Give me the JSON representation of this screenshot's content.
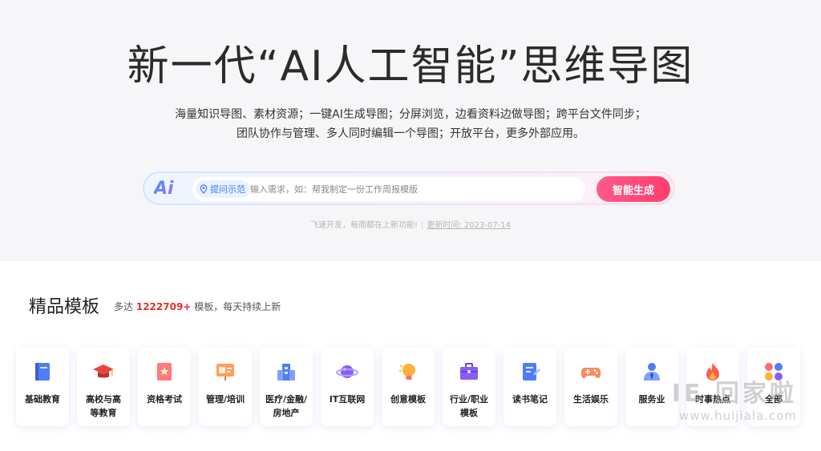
{
  "hero": {
    "title": "新一代“AI人工智能”思维导图",
    "desc_line1": "海量知识导图、素材资源；一键AI生成导图；分屏浏览，边看资料边做导图；跨平台文件同步；",
    "desc_line2": "团队协作与管理、多人同时编辑一个导图；开放平台，更多外部应用。"
  },
  "search": {
    "logo": "Ai",
    "hint_chip": "提问示范",
    "placeholder": "输入需求，如：帮我制定一份工作周报模版",
    "button": "智能生成"
  },
  "update": {
    "text": "飞速开发，每周都在上新功能!",
    "date": "更新时间: 2023-07-14"
  },
  "section": {
    "title": "精品模板",
    "sub_prefix": "多达",
    "count": "1222709+",
    "sub_suffix": "模板，每天持续上新"
  },
  "categories": [
    {
      "label": "基础教育",
      "icon": "book-icon"
    },
    {
      "label": "高校与高等教育",
      "icon": "graduation-cap-icon"
    },
    {
      "label": "资格考试",
      "icon": "certificate-icon"
    },
    {
      "label": "管理/培训",
      "icon": "presentation-icon"
    },
    {
      "label": "医疗/金融/房地产",
      "icon": "building-icon"
    },
    {
      "label": "IT互联网",
      "icon": "planet-icon"
    },
    {
      "label": "创意模板",
      "icon": "lightbulb-icon"
    },
    {
      "label": "行业/职业模板",
      "icon": "briefcase-icon"
    },
    {
      "label": "读书笔记",
      "icon": "notebook-icon"
    },
    {
      "label": "生活娱乐",
      "icon": "gamepad-icon"
    },
    {
      "label": "服务业",
      "icon": "service-icon"
    },
    {
      "label": "时事热点",
      "icon": "fire-icon"
    },
    {
      "label": "全部",
      "icon": "grid-icon"
    }
  ],
  "watermark": {
    "line1": "IE 回家啦",
    "line2": "www.huijiala.com"
  },
  "colors": {
    "accent_pink": "#ff3d6e",
    "accent_blue": "#3a7cf6",
    "count_red": "#e0322f"
  }
}
